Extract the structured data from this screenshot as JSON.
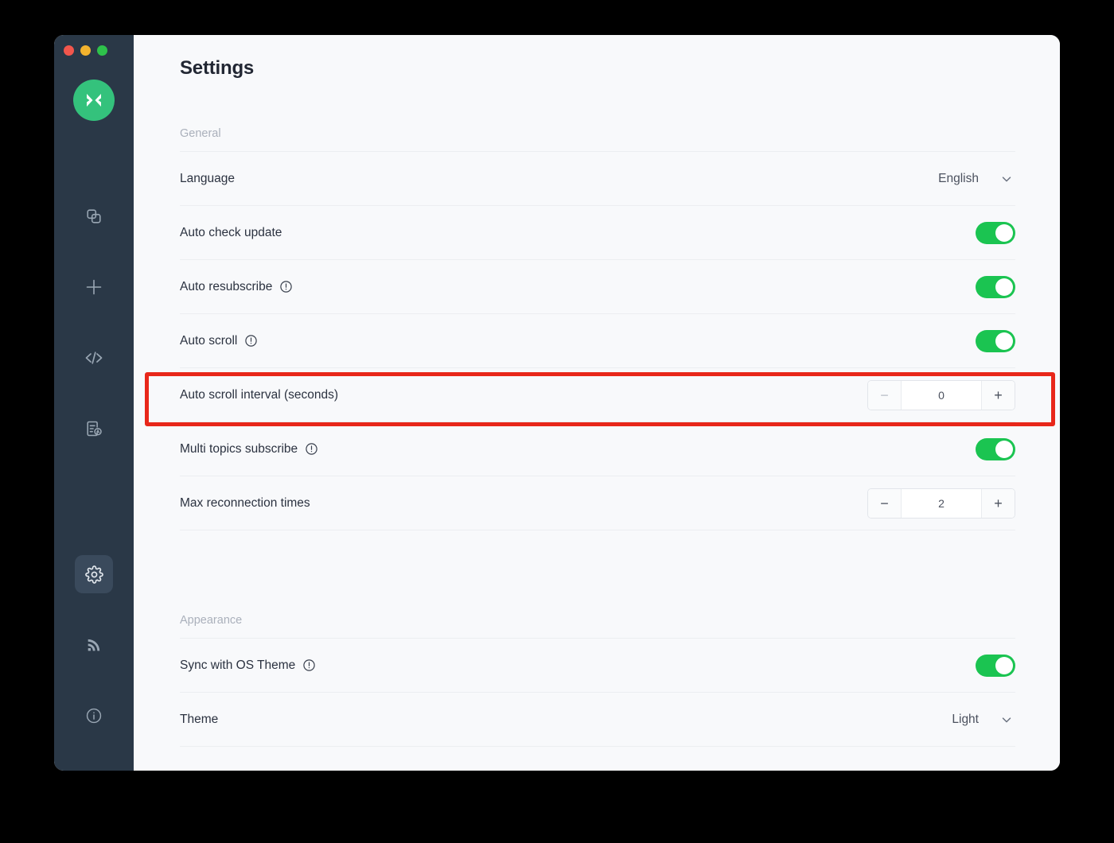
{
  "window": {
    "traffic_lights": [
      "close",
      "minimize",
      "maximize"
    ],
    "logo": "mqttx-logo-icon"
  },
  "sidebar": {
    "items": [
      {
        "name": "connections",
        "icon": "copy-squares-icon",
        "active": false
      },
      {
        "name": "new-connection",
        "icon": "plus-icon",
        "active": false
      },
      {
        "name": "scripts",
        "icon": "code-brackets-icon",
        "active": false
      },
      {
        "name": "log",
        "icon": "document-clock-icon",
        "active": false
      },
      {
        "name": "settings",
        "icon": "gear-icon",
        "active": true
      },
      {
        "name": "rss",
        "icon": "rss-signal-icon",
        "active": false
      },
      {
        "name": "about",
        "icon": "info-circle-icon",
        "active": false
      }
    ]
  },
  "header": {
    "title": "Settings"
  },
  "sections": [
    {
      "id": "general",
      "label": "General",
      "rows": [
        {
          "id": "language",
          "label": "Language",
          "control": "select",
          "value": "English",
          "icon": "chevron-down-icon"
        },
        {
          "id": "auto-check-update",
          "label": "Auto check update",
          "control": "toggle",
          "value": "on"
        },
        {
          "id": "auto-resubscribe",
          "label": "Auto resubscribe",
          "control": "toggle",
          "value": "on",
          "info": "info-circle-icon"
        },
        {
          "id": "auto-scroll",
          "label": "Auto scroll",
          "control": "toggle",
          "value": "on",
          "info": "info-circle-icon"
        },
        {
          "id": "auto-scroll-interval",
          "label": "Auto scroll interval (seconds)",
          "control": "stepper",
          "value": "0",
          "minus": "−",
          "plus": "+",
          "highlighted": true
        },
        {
          "id": "multi-topics-subscribe",
          "label": "Multi topics subscribe",
          "control": "toggle",
          "value": "on",
          "info": "info-circle-icon"
        },
        {
          "id": "max-reconnection-times",
          "label": "Max reconnection times",
          "control": "stepper",
          "value": "2",
          "minus": "−",
          "plus": "+"
        }
      ]
    },
    {
      "id": "appearance",
      "label": "Appearance",
      "rows": [
        {
          "id": "sync-with-os-theme",
          "label": "Sync with OS Theme",
          "control": "toggle",
          "value": "on",
          "info": "info-circle-icon"
        },
        {
          "id": "theme",
          "label": "Theme",
          "control": "select",
          "value": "Light",
          "icon": "chevron-down-icon"
        }
      ]
    }
  ],
  "annotation": {
    "highlight_color": "#e8271a",
    "target_row": "Auto scroll interval (seconds)"
  },
  "colors": {
    "sidebar_bg": "#2a3847",
    "accent_green": "#1bc451",
    "logo_green": "#34c27c",
    "content_bg": "#f8f9fb",
    "text_primary": "#2b3240",
    "text_muted": "#aab0bb"
  }
}
